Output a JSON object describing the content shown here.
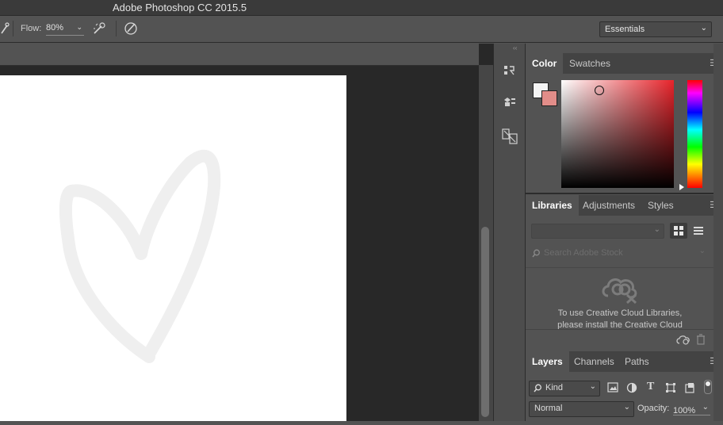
{
  "app": {
    "title": "Adobe Photoshop CC 2015.5"
  },
  "options": {
    "flow_label": "Flow:",
    "flow_value": "80%",
    "workspace_label": "Essentials"
  },
  "panels": {
    "color": {
      "tabs": [
        "Color",
        "Swatches"
      ],
      "foreground": "#f4f4f4",
      "background": "#e28d89"
    },
    "libraries": {
      "tabs": [
        "Libraries",
        "Adjustments",
        "Styles"
      ],
      "search_placeholder": "Search Adobe Stock",
      "message_line1": "To use Creative Cloud Libraries,",
      "message_line2": "please install the Creative Cloud"
    },
    "layers": {
      "tabs": [
        "Layers",
        "Channels",
        "Paths"
      ],
      "filter_label": "Kind",
      "blend_mode": "Normal",
      "opacity_label": "Opacity:",
      "opacity_value": "100%"
    }
  },
  "icons": {
    "brush": "brush-icon",
    "airbrush": "airbrush-icon",
    "pressure": "pressure-icon",
    "history": "history-icon",
    "properties": "properties-icon",
    "brush_presets": "brush-presets-icon"
  }
}
